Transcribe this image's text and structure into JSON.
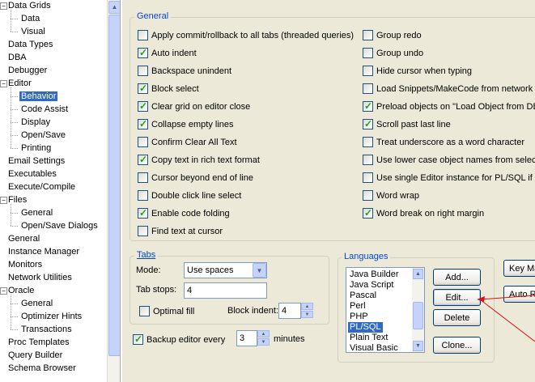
{
  "tree": {
    "items": [
      {
        "label": "Data Grids",
        "level": 0,
        "expander": "minus"
      },
      {
        "label": "Data",
        "level": 1
      },
      {
        "label": "Visual",
        "level": 1
      },
      {
        "label": "Data Types",
        "level": 0
      },
      {
        "label": "DBA",
        "level": 0
      },
      {
        "label": "Debugger",
        "level": 0
      },
      {
        "label": "Editor",
        "level": 0,
        "expander": "minus"
      },
      {
        "label": "Behavior",
        "level": 1,
        "selected": true
      },
      {
        "label": "Code Assist",
        "level": 1
      },
      {
        "label": "Display",
        "level": 1
      },
      {
        "label": "Open/Save",
        "level": 1
      },
      {
        "label": "Printing",
        "level": 1
      },
      {
        "label": "Email Settings",
        "level": 0
      },
      {
        "label": "Executables",
        "level": 0
      },
      {
        "label": "Execute/Compile",
        "level": 0
      },
      {
        "label": "Files",
        "level": 0,
        "expander": "minus"
      },
      {
        "label": "General",
        "level": 1
      },
      {
        "label": "Open/Save Dialogs",
        "level": 1
      },
      {
        "label": "General",
        "level": 0
      },
      {
        "label": "Instance Manager",
        "level": 0
      },
      {
        "label": "Monitors",
        "level": 0
      },
      {
        "label": "Network Utilities",
        "level": 0
      },
      {
        "label": "Oracle",
        "level": 0,
        "expander": "minus"
      },
      {
        "label": "General",
        "level": 1
      },
      {
        "label": "Optimizer Hints",
        "level": 1
      },
      {
        "label": "Transactions",
        "level": 1
      },
      {
        "label": "Proc Templates",
        "level": 0
      },
      {
        "label": "Query Builder",
        "level": 0
      },
      {
        "label": "Schema Browser",
        "level": 0
      }
    ]
  },
  "general": {
    "title": "General",
    "left": [
      {
        "label": "Apply commit/rollback to all tabs (threaded queries)",
        "checked": false
      },
      {
        "label": "Auto indent",
        "checked": true
      },
      {
        "label": "Backspace unindent",
        "checked": false
      },
      {
        "label": "Block select",
        "checked": true
      },
      {
        "label": "Clear grid on editor close",
        "checked": true
      },
      {
        "label": "Collapse empty lines",
        "checked": true
      },
      {
        "label": "Confirm Clear All Text",
        "checked": false
      },
      {
        "label": "Copy text in rich text format",
        "checked": true
      },
      {
        "label": "Cursor beyond end of line",
        "checked": false
      },
      {
        "label": "Double click line select",
        "checked": false
      },
      {
        "label": "Enable code folding",
        "checked": true
      },
      {
        "label": "Find text at cursor",
        "checked": false
      }
    ],
    "right": [
      {
        "label": "Group redo",
        "checked": false
      },
      {
        "label": "Group undo",
        "checked": false
      },
      {
        "label": "Hide cursor when typing",
        "checked": false
      },
      {
        "label": "Load Snippets/MakeCode from network s",
        "checked": false
      },
      {
        "label": "Preload objects on \"Load Object from DB\"",
        "checked": true
      },
      {
        "label": "Scroll past last line",
        "checked": true
      },
      {
        "label": "Treat underscore as a word character",
        "checked": false
      },
      {
        "label": "Use lower case object names from select",
        "checked": false
      },
      {
        "label": "Use single Editor instance for PL/SQL if po",
        "checked": false
      },
      {
        "label": "Word wrap",
        "checked": false
      },
      {
        "label": "Word break on right margin",
        "checked": true
      }
    ]
  },
  "tabs": {
    "title": "Tabs",
    "mode_label": "Mode:",
    "mode_value": "Use spaces",
    "tabstops_label": "Tab stops:",
    "tabstops_value": "4",
    "optimal_fill_label": "Optimal fill",
    "optimal_fill_checked": false,
    "block_indent_label": "Block indent:",
    "block_indent_value": "4"
  },
  "backup": {
    "label": "Backup editor every",
    "checked": true,
    "value": "3",
    "unit": "minutes"
  },
  "languages": {
    "title": "Languages",
    "items": [
      "Java Builder",
      "Java Script",
      "Pascal",
      "Perl",
      "PHP",
      "PL/SQL",
      "Plain Text",
      "Visual Basic"
    ],
    "selected_index": 5,
    "buttons": {
      "add": "Add...",
      "edit": "Edit...",
      "delete": "Delete",
      "clone": "Clone..."
    }
  },
  "side_buttons": {
    "keymap": "Key Ma",
    "auto": "Auto R"
  },
  "colors": {
    "accent": "#316AC5",
    "group_title": "#0046D5",
    "check": "#21A121",
    "annotation": "#E01010"
  }
}
